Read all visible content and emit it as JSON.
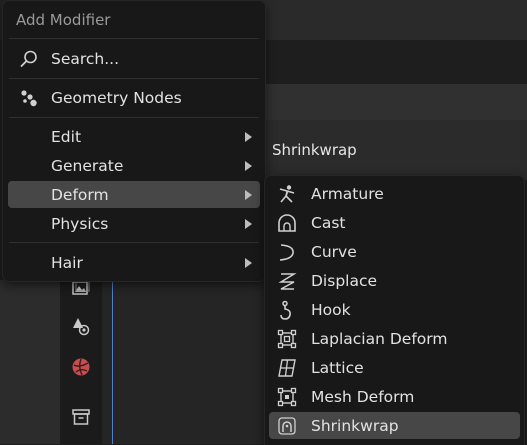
{
  "menu": {
    "title": "Add Modifier",
    "search_label": "Search...",
    "geometry_nodes_label": "Geometry Nodes",
    "categories": [
      {
        "label": "Edit",
        "has_submenu": true
      },
      {
        "label": "Generate",
        "has_submenu": true
      },
      {
        "label": "Deform",
        "has_submenu": true,
        "active": true
      },
      {
        "label": "Physics",
        "has_submenu": true
      },
      {
        "label": "Hair",
        "has_submenu": true
      }
    ]
  },
  "submenu": {
    "items": [
      {
        "label": "Armature",
        "icon": "armature-icon"
      },
      {
        "label": "Cast",
        "icon": "cast-icon"
      },
      {
        "label": "Curve",
        "icon": "curve-icon"
      },
      {
        "label": "Displace",
        "icon": "displace-icon"
      },
      {
        "label": "Hook",
        "icon": "hook-icon"
      },
      {
        "label": "Laplacian Deform",
        "icon": "laplacian-deform-icon"
      },
      {
        "label": "Lattice",
        "icon": "lattice-icon"
      },
      {
        "label": "Mesh Deform",
        "icon": "mesh-deform-icon"
      },
      {
        "label": "Shrinkwrap",
        "icon": "shrinkwrap-icon",
        "active": true
      }
    ]
  },
  "background": {
    "panel_title": "Shrinkwrap"
  },
  "colors": {
    "menu_bg": "#181818",
    "highlight": "#474747",
    "accent_red": "#c74e4e",
    "outliner_line": "#4f7fcc"
  }
}
